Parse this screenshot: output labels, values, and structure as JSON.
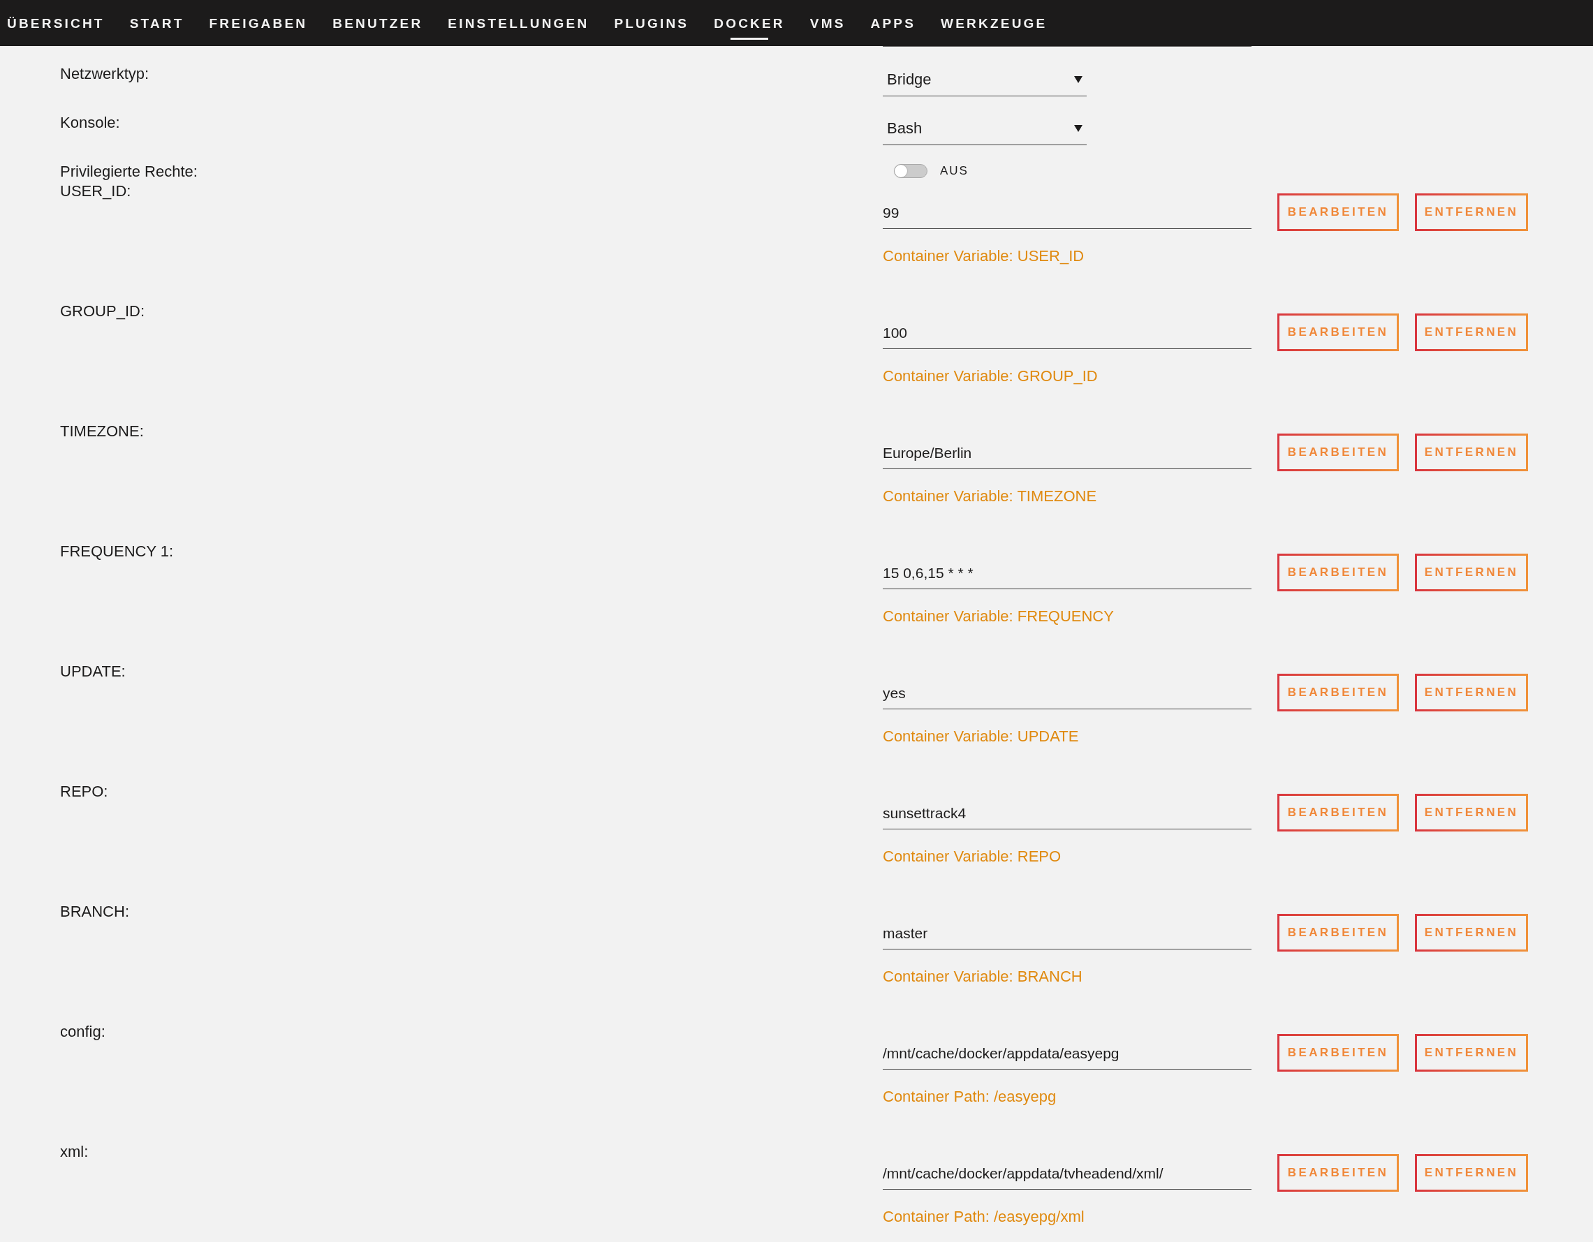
{
  "nav": [
    {
      "label": "ÜBERSICHT",
      "selected": false
    },
    {
      "label": "START",
      "selected": false
    },
    {
      "label": "FREIGABEN",
      "selected": false
    },
    {
      "label": "BENUTZER",
      "selected": false
    },
    {
      "label": "EINSTELLUNGEN",
      "selected": false
    },
    {
      "label": "PLUGINS",
      "selected": false
    },
    {
      "label": "DOCKER",
      "selected": true
    },
    {
      "label": "VMS",
      "selected": false
    },
    {
      "label": "APPS",
      "selected": false
    },
    {
      "label": "WERKZEUGE",
      "selected": false
    }
  ],
  "settings": [
    {
      "kind": "select",
      "label": "Netzwerktyp:",
      "value": "Bridge"
    },
    {
      "kind": "select",
      "label": "Konsole:",
      "value": "Bash"
    },
    {
      "kind": "toggle",
      "label": "Privilegierte Rechte:",
      "on": false,
      "state_label": "AUS"
    }
  ],
  "variables": [
    {
      "label": "USER_ID:",
      "value": "99",
      "hint": "Container Variable: USER_ID",
      "buttons": [
        "BEARBEITEN",
        "ENTFERNEN"
      ]
    },
    {
      "label": "GROUP_ID:",
      "value": "100",
      "hint": "Container Variable: GROUP_ID",
      "buttons": [
        "BEARBEITEN",
        "ENTFERNEN"
      ]
    },
    {
      "label": "TIMEZONE:",
      "value": "Europe/Berlin",
      "hint": "Container Variable: TIMEZONE",
      "buttons": [
        "BEARBEITEN",
        "ENTFERNEN"
      ]
    },
    {
      "label": "FREQUENCY 1:",
      "value": "15 0,6,15 * * *",
      "hint": "Container Variable: FREQUENCY",
      "buttons": [
        "BEARBEITEN",
        "ENTFERNEN"
      ]
    },
    {
      "label": "UPDATE:",
      "value": "yes",
      "hint": "Container Variable: UPDATE",
      "buttons": [
        "BEARBEITEN",
        "ENTFERNEN"
      ]
    },
    {
      "label": "REPO:",
      "value": "sunsettrack4",
      "hint": "Container Variable: REPO",
      "buttons": [
        "BEARBEITEN",
        "ENTFERNEN"
      ]
    },
    {
      "label": "BRANCH:",
      "value": "master",
      "hint": "Container Variable: BRANCH",
      "buttons": [
        "BEARBEITEN",
        "ENTFERNEN"
      ]
    },
    {
      "label": "config:",
      "value": "/mnt/cache/docker/appdata/easyepg",
      "hint": "Container Path: /easyepg",
      "buttons": [
        "BEARBEITEN",
        "ENTFERNEN"
      ]
    },
    {
      "label": "xml:",
      "value": "/mnt/cache/docker/appdata/tvheadend/xml/",
      "hint": "Container Path: /easyepg/xml",
      "buttons": [
        "BEARBEITEN",
        "ENTFERNEN"
      ]
    }
  ]
}
